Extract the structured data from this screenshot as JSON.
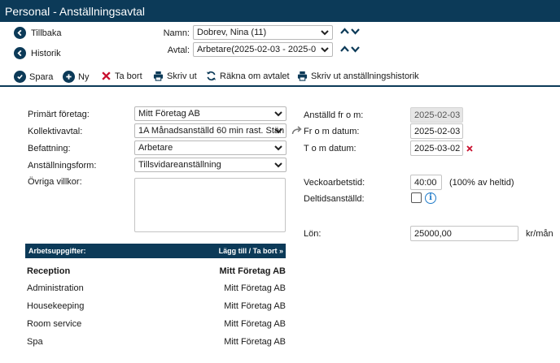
{
  "window": {
    "title": "Personal - Anställningsavtal"
  },
  "nav": {
    "back": "Tillbaka",
    "history": "Historik"
  },
  "header": {
    "name_label": "Namn:",
    "name_value": "Dobrev, Nina (11)",
    "contract_label": "Avtal:",
    "contract_value": "Arbetare(2025-02-03 - 2025-0"
  },
  "toolbar": {
    "save": "Spara",
    "new": "Ny",
    "delete": "Ta bort",
    "print": "Skriv ut",
    "recalc": "Räkna om avtalet",
    "print_history": "Skriv ut anställningshistorik"
  },
  "form": {
    "company_label": "Primärt företag:",
    "company_value": "Mitt Företag AB",
    "agreement_label": "Kollektivavtal:",
    "agreement_value": "1A Månadsanställd 60 min rast. Stän",
    "position_label": "Befattning:",
    "position_value": "Arbetare",
    "employment_form_label": "Anställningsform:",
    "employment_form_value": "Tillsvidareanställning",
    "other_terms_label": "Övriga villkor:",
    "other_terms_value": "",
    "employed_from_label": "Anställd fr o m:",
    "employed_from_value": "2025-02-03",
    "from_date_label": "Fr o m datum:",
    "from_date_value": "2025-02-03",
    "to_date_label": "T o m datum:",
    "to_date_value": "2025-03-02",
    "weekly_hours_label": "Veckoarbetstid:",
    "weekly_hours_value": "40:00",
    "weekly_hours_note": "(100% av heltid)",
    "part_time_label": "Deltidsanställd:",
    "salary_label": "Lön:",
    "salary_value": "25000,00",
    "salary_unit": "kr/mån"
  },
  "tasks": {
    "header": "Arbetsuppgifter:",
    "action": "Lägg till / Ta bort »",
    "rows": [
      {
        "name": "Reception",
        "company": "Mitt Företag AB"
      },
      {
        "name": "Administration",
        "company": "Mitt Företag AB"
      },
      {
        "name": "Housekeeping",
        "company": "Mitt Företag AB"
      },
      {
        "name": "Room service",
        "company": "Mitt Företag AB"
      },
      {
        "name": "Spa",
        "company": "Mitt Företag AB"
      }
    ]
  },
  "colors": {
    "brand": "#0c3a58",
    "delete": "#c8102e",
    "info": "#1e7ac8"
  }
}
